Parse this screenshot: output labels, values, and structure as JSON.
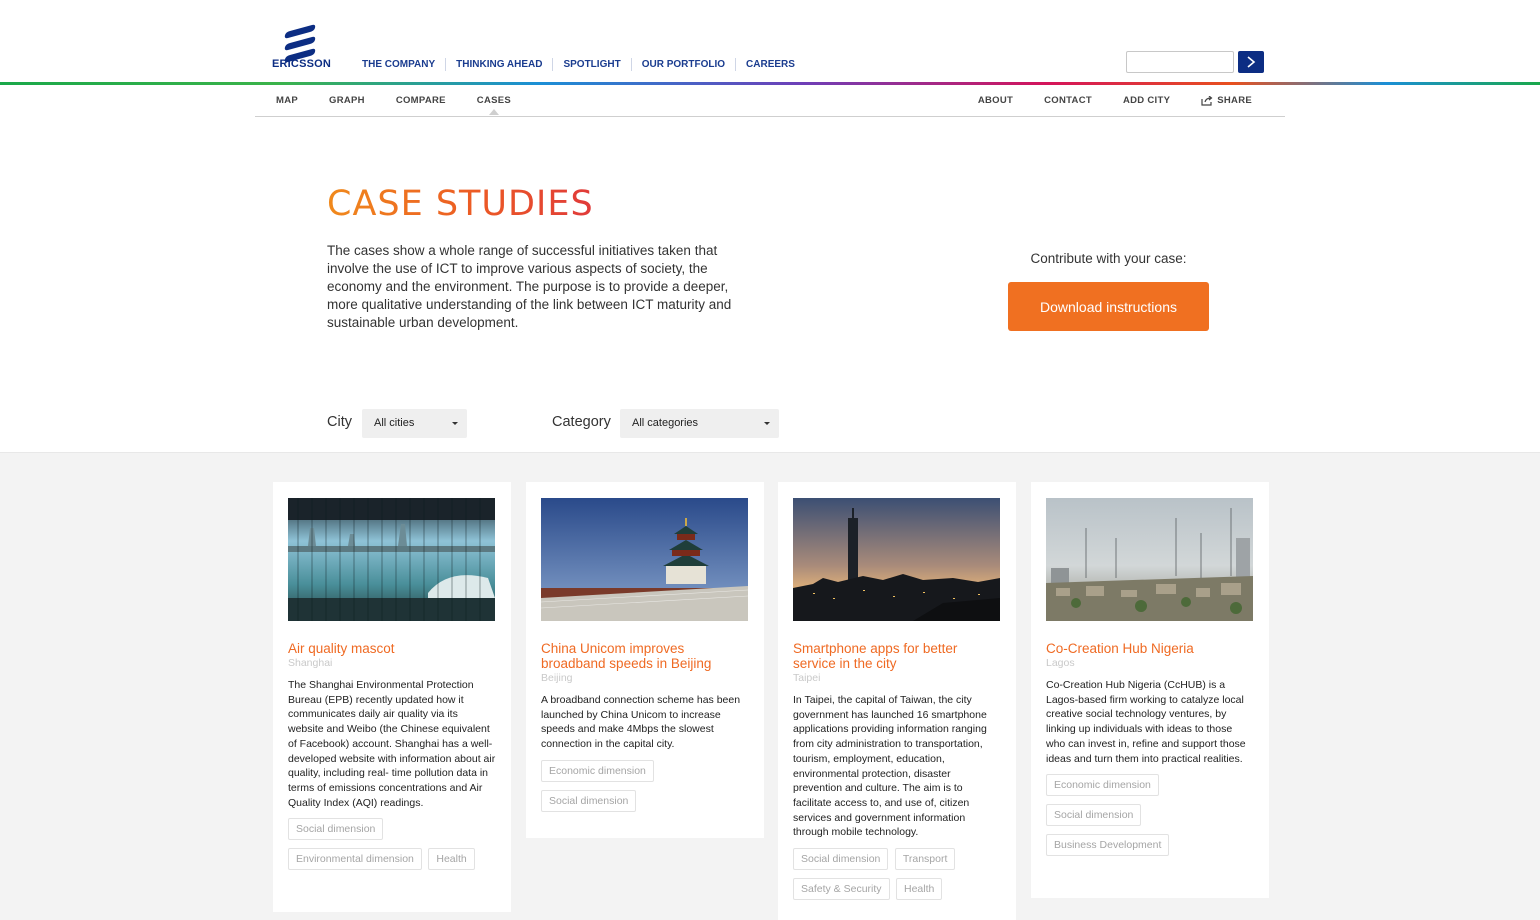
{
  "header": {
    "brand": "ERICSSON",
    "nav": [
      "THE COMPANY",
      "THINKING AHEAD",
      "SPOTLIGHT",
      "OUR PORTFOLIO",
      "CAREERS"
    ],
    "search": {
      "value": "",
      "placeholder": ""
    },
    "colors": {
      "brand_blue": "#0c2d83"
    }
  },
  "subnav": {
    "left": [
      "MAP",
      "GRAPH",
      "COMPARE",
      "CASES"
    ],
    "active": "CASES",
    "right": [
      "ABOUT",
      "CONTACT",
      "ADD CITY",
      "SHARE"
    ]
  },
  "hero": {
    "title": "CASE STUDIES",
    "intro": "The cases show a whole range of successful initiatives taken that involve the use of ICT to improve various aspects of society, the economy and the environment. The purpose is to provide a deeper, more qualitative understanding of the link between ICT maturity and sustainable urban development.",
    "contribute_label": "Contribute with your case:",
    "download_label": "Download instructions",
    "accent_color": "#f07021"
  },
  "filters": {
    "city_label": "City",
    "city_value": "All cities",
    "category_label": "Category",
    "category_value": "All categories"
  },
  "cards": [
    {
      "title": "Air quality mascot",
      "city": "Shanghai",
      "description": "The Shanghai Environmental Protection Bureau (EPB) recently updated how it communicates daily air quality via its website and Weibo (the Chinese equivalent of Facebook) account. Shanghai has a well-developed website with information about air quality, including real- time pollution data in terms of emissions concentrations and Air Quality Index (AQI) readings.",
      "tags": [
        "Social dimension",
        "Environmental dimension",
        "Health"
      ]
    },
    {
      "title": "China Unicom improves broadband speeds in Beijing",
      "city": "Beijing",
      "description": "A broadband connection scheme has been launched by China Unicom to increase speeds and make 4Mbps the slowest connection in the capital city.",
      "tags": [
        "Economic dimension",
        "Social dimension"
      ]
    },
    {
      "title": "Smartphone apps for better service in the city",
      "city": "Taipei",
      "description": "In Taipei, the capital of Taiwan, the city government has launched 16 smartphone applications providing information ranging from city administration to transportation, tourism, employment, education, environmental protection, disaster prevention and culture. The aim is to facilitate access to, and use of, citizen services and government information through mobile technology.",
      "tags": [
        "Social dimension",
        "Transport",
        "Safety & Security",
        "Health"
      ]
    },
    {
      "title": "Co-Creation Hub Nigeria",
      "city": "Lagos",
      "description": "Co-Creation Hub Nigeria (CcHUB) is a Lagos-based firm working to catalyze local creative social technology ventures, by linking up individuals with ideas to those who can invest in, refine and support those ideas and turn them into practical realities.",
      "tags": [
        "Economic dimension",
        "Social dimension",
        "Business Development"
      ]
    }
  ]
}
